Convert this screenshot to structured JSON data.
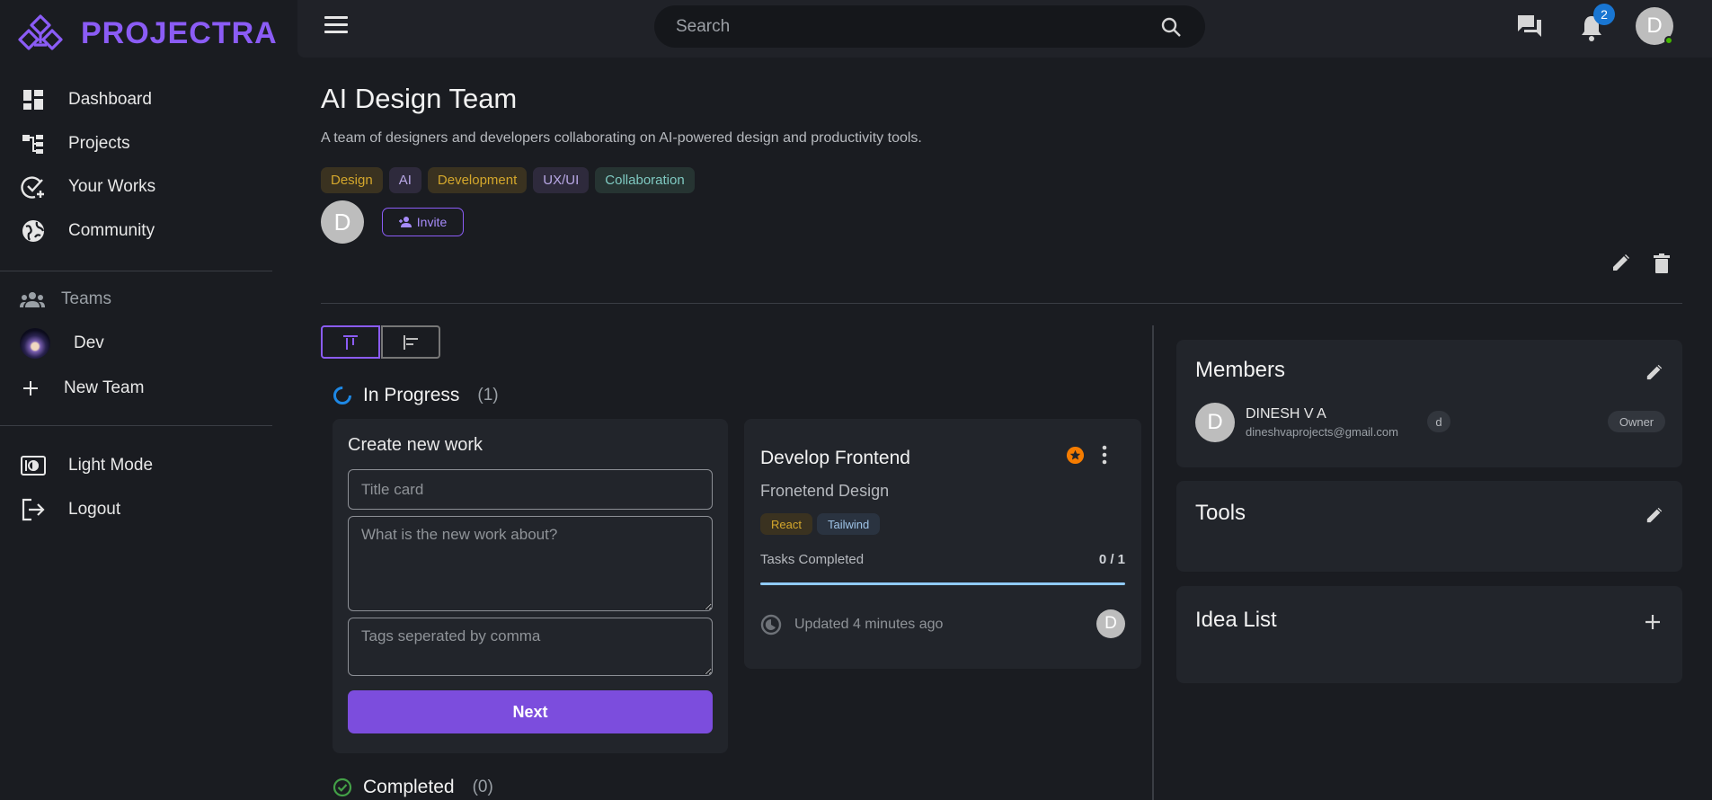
{
  "app": {
    "brand": "PROJECTRA"
  },
  "sidebar": {
    "nav": [
      {
        "label": "Dashboard",
        "icon": "dashboard-icon"
      },
      {
        "label": "Projects",
        "icon": "projects-tree-icon"
      },
      {
        "label": "Your Works",
        "icon": "task-check-icon"
      },
      {
        "label": "Community",
        "icon": "globe-icon"
      }
    ],
    "teams_header": "Teams",
    "teams": [
      {
        "label": "Dev"
      }
    ],
    "new_team": "New Team",
    "light_mode": "Light Mode",
    "logout": "Logout"
  },
  "topbar": {
    "search_placeholder": "Search",
    "notification_count": "2",
    "avatar_initial": "D"
  },
  "team": {
    "title": "AI Design Team",
    "description": "A team of designers and developers collaborating on AI-powered design and productivity tools.",
    "tags": [
      {
        "label": "Design",
        "color": "#d4a72c",
        "bg": "#3a3220"
      },
      {
        "label": "AI",
        "color": "#b9a8e6",
        "bg": "#2e2a3c"
      },
      {
        "label": "Development",
        "color": "#d4a72c",
        "bg": "#3a3220"
      },
      {
        "label": "UX/UI",
        "color": "#b9a8e6",
        "bg": "#2e2a3c"
      },
      {
        "label": "Collaboration",
        "color": "#7fc9c1",
        "bg": "#263432"
      }
    ],
    "member_initial": "D",
    "invite_label": "Invite"
  },
  "board": {
    "in_progress": {
      "title": "In Progress",
      "count": "(1)"
    },
    "completed": {
      "title": "Completed",
      "count": "(0)"
    },
    "create": {
      "title": "Create new work",
      "title_placeholder": "Title card",
      "about_placeholder": "What is the new work about?",
      "tags_placeholder": "Tags seperated by comma",
      "next_label": "Next"
    },
    "work": {
      "title": "Develop Frontend",
      "subtitle": "Fronetend Design",
      "tags": [
        {
          "label": "React",
          "color": "#d4a72c",
          "bg": "#3a3220"
        },
        {
          "label": "Tailwind",
          "color": "#9ec3e6",
          "bg": "#2a3340"
        }
      ],
      "tasks_label": "Tasks Completed",
      "tasks_count": "0 / 1",
      "progress": 0,
      "updated": "Updated 4 minutes ago",
      "avatar_initial": "D"
    }
  },
  "members": {
    "title": "Members",
    "list": [
      {
        "initial": "D",
        "name": "DINESH V A",
        "email": "dineshvaprojects@gmail.com",
        "chip": "d",
        "role": "Owner"
      }
    ]
  },
  "tools": {
    "title": "Tools"
  },
  "ideas": {
    "title": "Idea List"
  },
  "colors": {
    "accent": "#8b5cf6",
    "button": "#7c4ddd",
    "background": "#1a1c21",
    "card": "#22252b"
  }
}
